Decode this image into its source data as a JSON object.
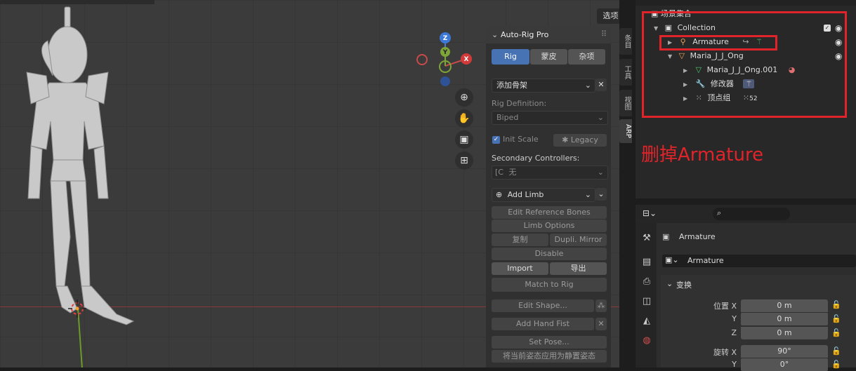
{
  "viewport": {
    "select_menu": "选项",
    "gizmo": {
      "z": "Z",
      "y": "Y",
      "x": "X"
    },
    "nav_icons": [
      "zoom-icon",
      "hand-pan-icon",
      "camera-icon",
      "grid-icon"
    ]
  },
  "side_tabs": [
    "条目",
    "工具",
    "视图",
    "ARP"
  ],
  "arp": {
    "title": "Auto-Rig Pro",
    "tabs": [
      "Rig",
      "蒙皮",
      "杂项"
    ],
    "add_armature": "添加骨架",
    "rig_definition_label": "Rig Definition:",
    "rig_definition_value": "Biped",
    "init_scale": "Init Scale",
    "legacy": "Legacy",
    "secondary_label": "Secondary Controllers:",
    "secondary_value": "无",
    "add_limb": "Add Limb",
    "edit_reference_bones": "Edit Reference Bones",
    "limb_options": "Limb Options",
    "copy": "复制",
    "dupli_mirror": "Dupli. Mirror",
    "disable": "Disable",
    "import": "Import",
    "export": "导出",
    "match_to_rig": "Match to Rig",
    "edit_shape": "Edit Shape...",
    "add_hand_fist": "Add Hand Fist",
    "set_pose": "Set Pose...",
    "apply_rest": "将当前姿态应用为静置姿态"
  },
  "outliner": {
    "scene_collection": "场景集合",
    "collection": "Collection",
    "armature": "Armature",
    "mesh_object": "Maria_J_J_Ong",
    "mesh_data": "Maria_J_J_Ong.001",
    "modifiers": "修改器",
    "vertex_groups": "顶点组",
    "vertex_groups_count": "52"
  },
  "annotation": "删掉Armature",
  "colors": {
    "annotation": "#e0242a",
    "accent": "#4772b3"
  },
  "properties": {
    "object_name": "Armature",
    "object_field": "Armature",
    "section": "变换",
    "location_label": "位置 X",
    "rotation_label": "旋转 X",
    "y_label": "Y",
    "z_label": "Z",
    "loc_x": "0 m",
    "loc_y": "0 m",
    "loc_z": "0 m",
    "rot_x": "90°",
    "rot_y": "0°"
  }
}
